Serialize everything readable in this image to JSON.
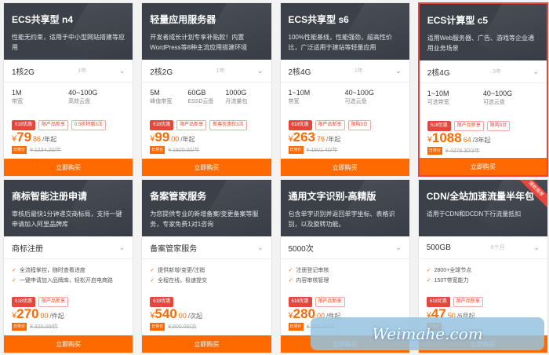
{
  "cards": [
    {
      "title": "ECS共享型 n4",
      "desc": "性能无约束，适用于中小型网站搭建等应用",
      "config": "1核2G",
      "years": "1年",
      "specs": [
        {
          "value": "1M",
          "label": "带宽"
        },
        {
          "value": "40~100G",
          "label": "高效云盘"
        }
      ],
      "tags": [
        "618优惠",
        "限产品新享",
        "0.5折特惠3次"
      ],
      "cur": "¥",
      "price_int": "79",
      "price_dec": "86",
      "unit": "/年起",
      "badge": "日常价",
      "orig": "¥ 1234.20/年",
      "buy": "立即购买"
    },
    {
      "title": "轻量应用服务器",
      "desc": "开发者成长计划专享补贴款！内置WordPress等8种主流应用搭建环境",
      "config": "2核2G",
      "years": "1年",
      "specs": [
        {
          "value": "5M",
          "label": "峰值带宽"
        },
        {
          "value": "60GB",
          "label": "ESSD云盘"
        },
        {
          "value": "1000G",
          "label": "月流量包"
        }
      ],
      "tags": [
        "618优惠",
        "限产品新享",
        "新客优惠仅3次"
      ],
      "cur": "¥",
      "price_int": "99",
      "price_dec": "00",
      "unit": "/年起",
      "badge": "日常价",
      "orig": "¥ 1920.00/年",
      "buy": "立即购买"
    },
    {
      "title": "ECS共享型 s6",
      "desc": "100%性能基线，性能强劲，超高性价比，广泛适用于建站等轻量应用",
      "config": "2核4G",
      "years": "1年",
      "specs": [
        {
          "value": "1~10M",
          "label": "带宽"
        },
        {
          "value": "40~100G",
          "label": "可选云盘"
        }
      ],
      "tags": [
        "618优惠",
        "限产品新享",
        "限购3台"
      ],
      "cur": "¥",
      "price_int": "263",
      "price_dec": "76",
      "unit": "/年起",
      "badge": "日常价",
      "orig": "¥ 1601.40/年",
      "buy": "立即购买"
    },
    {
      "title": "ECS计算型 c5",
      "desc": "适用Web服务器、广告、游戏等企业通用业务场景",
      "config": "2核4G",
      "years": "3年",
      "specs": [
        {
          "value": "1~10M",
          "label": "可选带宽"
        },
        {
          "value": "40~100G",
          "label": "可选云盘"
        }
      ],
      "tags": [
        "618优惠",
        "限产品新享",
        "限购3台"
      ],
      "cur": "¥",
      "price_int": "1088",
      "price_dec": "64",
      "unit": "/3年起",
      "badge": "日常价",
      "orig": "¥ 4278.30/3年",
      "buy": "立即购买"
    },
    {
      "title": "商标智能注册申请",
      "desc": "审核后最快1分钟递交商标局，支持一键申请加入阿里品牌库",
      "config": "商标注册",
      "feats": [
        "全流程掌控，随时查看进度",
        "一键申请加入品牌库，轻松开启电商路"
      ],
      "tags": [
        "618优惠",
        "限产品新享"
      ],
      "cur": "¥",
      "price_int": "270",
      "price_dec": "00",
      "unit": "/件起",
      "badge": "日常价",
      "orig": "¥ 320.00/件",
      "buy": "立即购买"
    },
    {
      "title": "备案管家服务",
      "desc": "为您提供专业的新增备案/变更备案等服务，专家免费1对1咨询",
      "config": "备案管家服务",
      "feats": [
        "提供新增/变更/注销",
        "全程在线，极速提交"
      ],
      "tags": [
        "618优惠"
      ],
      "cur": "¥",
      "price_int": "540",
      "price_dec": "00",
      "unit": "/次起",
      "badge": "日常价",
      "orig": "¥ 600.00/次",
      "buy": "立即购买"
    },
    {
      "title": "通用文字识别-高精版",
      "desc": "包含单字识别并返回单字坐标、表格识别，以及旋转功能。",
      "config": "5000次",
      "feats": [
        "注册登记审核",
        "内容审核管理"
      ],
      "tags": [
        "618优惠",
        "限产品新享"
      ],
      "cur": "¥",
      "price_int": "280",
      "price_dec": "00",
      "unit": "/件起",
      "badge": "日常价",
      "orig": "¥ 320.00/件",
      "buy": "立即购买"
    },
    {
      "title": "CDN/全站加速流量半年包",
      "desc": "适用于CDN和DCDN下行流量抵扣",
      "config": "500GB",
      "years": "6个月",
      "feats": [
        "2800+全球节点",
        "150T带宽能力"
      ],
      "tags": [
        "618优惠",
        "限产品新享"
      ],
      "cur": "¥",
      "price_int": "47",
      "price_dec": "50",
      "unit": "/6月起",
      "badge": "日常价",
      "orig": "",
      "buy": "立即购买",
      "ribbon": "爆款推荐"
    }
  ],
  "watermark": "Weimahe.com"
}
